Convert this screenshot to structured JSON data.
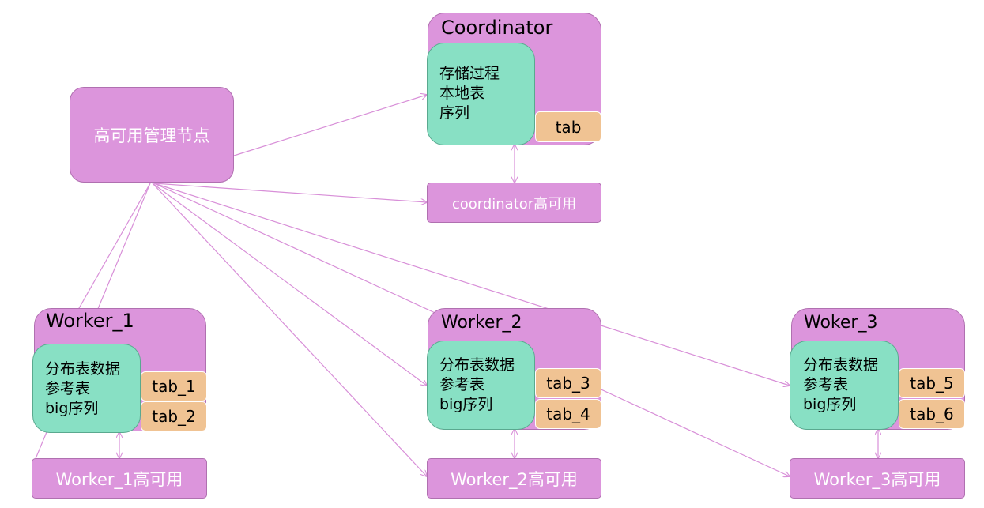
{
  "manager": {
    "label": "高可用管理节点"
  },
  "coordinator": {
    "title": "Coordinator",
    "items": [
      "存储过程",
      "本地表",
      "序列"
    ],
    "tab": "tab",
    "ha_label": "coordinator高可用"
  },
  "workers": [
    {
      "title": "Worker_1",
      "items": [
        "分布表数据",
        "参考表",
        "big序列"
      ],
      "tabs": [
        "tab_1",
        "tab_2"
      ],
      "ha_label": "Worker_1高可用"
    },
    {
      "title": "Worker_2",
      "items": [
        "分布表数据",
        "参考表",
        "big序列"
      ],
      "tabs": [
        "tab_3",
        "tab_4"
      ],
      "ha_label": "Worker_2高可用"
    },
    {
      "title": "Woker_3",
      "items": [
        "分布表数据",
        "参考表",
        "big序列"
      ],
      "tabs": [
        "tab_5",
        "tab_6"
      ],
      "ha_label": "Worker_3高可用"
    }
  ],
  "colors": {
    "node": "#dc95dc",
    "inner": "#88e0c4",
    "tab": "#f0c393",
    "edge": "#d88fd8"
  }
}
